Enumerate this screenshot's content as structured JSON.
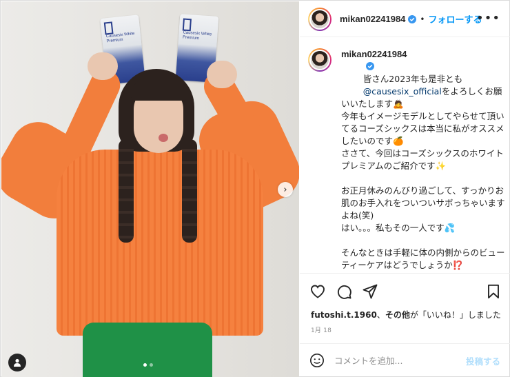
{
  "post": {
    "username": "mikan02241984",
    "separator": "•",
    "follow_label": "フォローする",
    "more_label": "•••",
    "caption_intro": "皆さん2023年も是非とも",
    "caption_mention": "@causesix_official",
    "caption_body": "をよろしくお願いいたします🙇\n今年もイメージモデルとしてやらせて頂いてるコーズシックスは本当に私がオススメ\nしたいのです🍊\nささて、今回はコーズシックスのホワイトプレミアムのご紹介です✨\n\nお正月休みのんびり過ごして、すっかりお肌のお手入れをついついサボっちゃいますよね(笑)\nはい。。。私もその一人です💦\n\nそんなときは手軽に体の内側からのビューティーケアはどうでしょうか⁉️\n\nホワイトプレミアムは錠剤ですが小粒",
    "likes_user": "futoshi.t.1960",
    "likes_sep": "、",
    "likes_others": "その他",
    "likes_tail": "が「いいね！」しました",
    "date": "1月 18",
    "comment_placeholder": "コメントを追加...",
    "post_button": "投稿する",
    "product_label": "Causesix White Premium"
  },
  "icons": {
    "verified": "verified-badge-icon",
    "more": "more-options-icon",
    "like": "heart-icon",
    "comment": "comment-icon",
    "share": "send-icon",
    "save": "bookmark-icon",
    "emoji": "emoji-icon",
    "next": "chevron-right-icon",
    "user_tag": "user-tag-icon"
  },
  "colors": {
    "accent": "#0095f6",
    "verified": "#3897f0",
    "mention": "#00376b",
    "muted": "#8e8e8e"
  },
  "carousel": {
    "count": 2,
    "active": 1
  }
}
